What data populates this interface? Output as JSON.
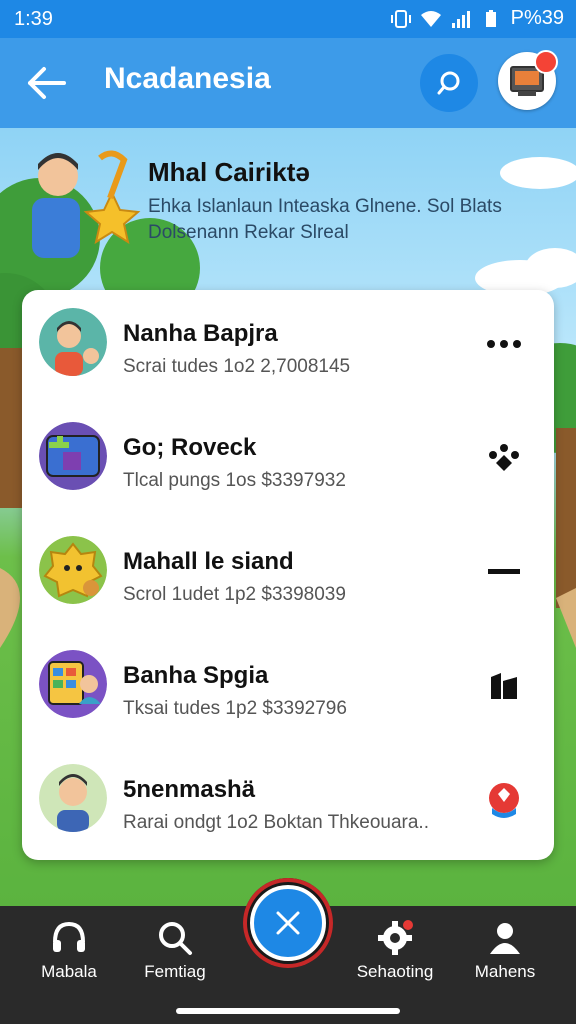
{
  "status_bar": {
    "time": "1:39",
    "battery": "P%39"
  },
  "app_bar": {
    "title": "Ncadanesia"
  },
  "banner": {
    "title": "Mhal Cairiktə",
    "subtitle_line1": "Ehka Islanlaun Inteaska Glnene. Sol Blats",
    "subtitle_line2": "Dolsenann Rekar Slreal"
  },
  "list": [
    {
      "name": "Nanha Bapjra",
      "meta": "Scrai tudes 1o2  2,7008145",
      "action_icon": "more-icon"
    },
    {
      "name": "Go; Roveck",
      "meta": "Tlcal pungs 1os  $3397932",
      "action_icon": "paw-icon"
    },
    {
      "name": "Mahall le siand",
      "meta": "Scrol 1udet 1p2  $3398039",
      "action_icon": "minus-icon"
    },
    {
      "name": "Banha Spgia",
      "meta": "Tksai tudes 1p2  $3392796",
      "action_icon": "flag-icon"
    },
    {
      "name": "5nenmashä",
      "meta": "Rarai ondgt 1o2  Boktan Thkeouara..",
      "action_icon": "badge-icon"
    }
  ],
  "bottom_nav": [
    {
      "label": "Mabala",
      "icon": "headset-icon"
    },
    {
      "label": "Femtiag",
      "icon": "search-icon"
    },
    {
      "label": "Sehaoting",
      "icon": "gear-icon"
    },
    {
      "label": "Mahens",
      "icon": "person-icon"
    }
  ],
  "colors": {
    "primary": "#1e88e5",
    "appbar": "#3d9be9",
    "nav": "#2a2a2a",
    "alert": "#f44336"
  }
}
